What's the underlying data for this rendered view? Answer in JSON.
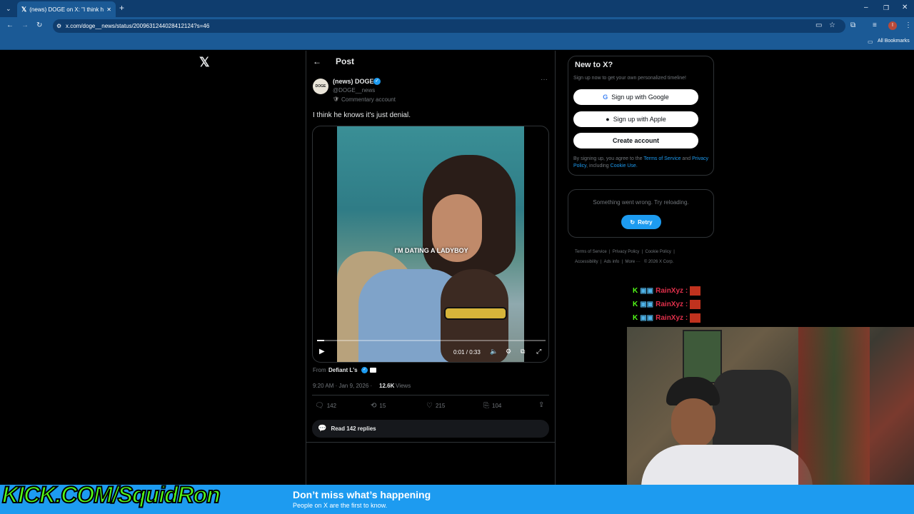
{
  "browser": {
    "tab_title": "(news) DOGE on X: \"I think he k",
    "url": "x.com/doge__news/status/2009631244028412124?s=46",
    "bookmarks_label": "All Bookmarks",
    "profile_initial": "I"
  },
  "x": {
    "logo": "𝕏",
    "header_title": "Post",
    "author": {
      "name": "(news) DOGE",
      "handle": "@DOGE__news",
      "label": "Commentary account",
      "avatar_text": "DOGE"
    },
    "tweet_text": "I think he knows it's just denial.",
    "video": {
      "caption": "I'M DATING A LADYBOY",
      "time": "0:01 / 0:33",
      "progress": 0.03
    },
    "from_prefix": "From",
    "from_name": "Defiant L's",
    "timestamp": "9:20 AM · Jan 9, 2026 ·",
    "views_count": "12.6K",
    "views_label": "Views",
    "actions": {
      "replies": "142",
      "reposts": "15",
      "likes": "215",
      "bookmarks": "104"
    },
    "read_replies": "Read 142 replies"
  },
  "sidebar": {
    "new_title": "New to X?",
    "new_sub": "Sign up now to get your own personalized timeline!",
    "google": "Sign up with Google",
    "apple": "Sign up with Apple",
    "create": "Create account",
    "legal_1": "By signing up, you agree to the",
    "legal_tos": "Terms of Service",
    "legal_and": "and",
    "legal_privacy": "Privacy Policy",
    "legal_including": ", including",
    "legal_cookie": "Cookie Use.",
    "error_text": "Something went wrong. Try reloading.",
    "retry": "Retry",
    "footer": {
      "tos": "Terms of Service",
      "privacy": "Privacy Policy",
      "cookie": "Cookie Policy",
      "accessibility": "Accessibility",
      "ads": "Ads info",
      "more": "More ···",
      "copyright": "© 2026 X Corp."
    }
  },
  "stream": {
    "chat_name": "RainXyz :",
    "kick_text": "KICK.COM/SquidRon"
  },
  "banner": {
    "title": "Don’t miss what’s happening",
    "subtitle": "People on X are the first to know."
  },
  "colors": {
    "chrome_dark": "#0f3d6e",
    "chrome": "#1b5a96",
    "x_blue": "#1d9bf0",
    "kick_green": "#53fc18"
  }
}
